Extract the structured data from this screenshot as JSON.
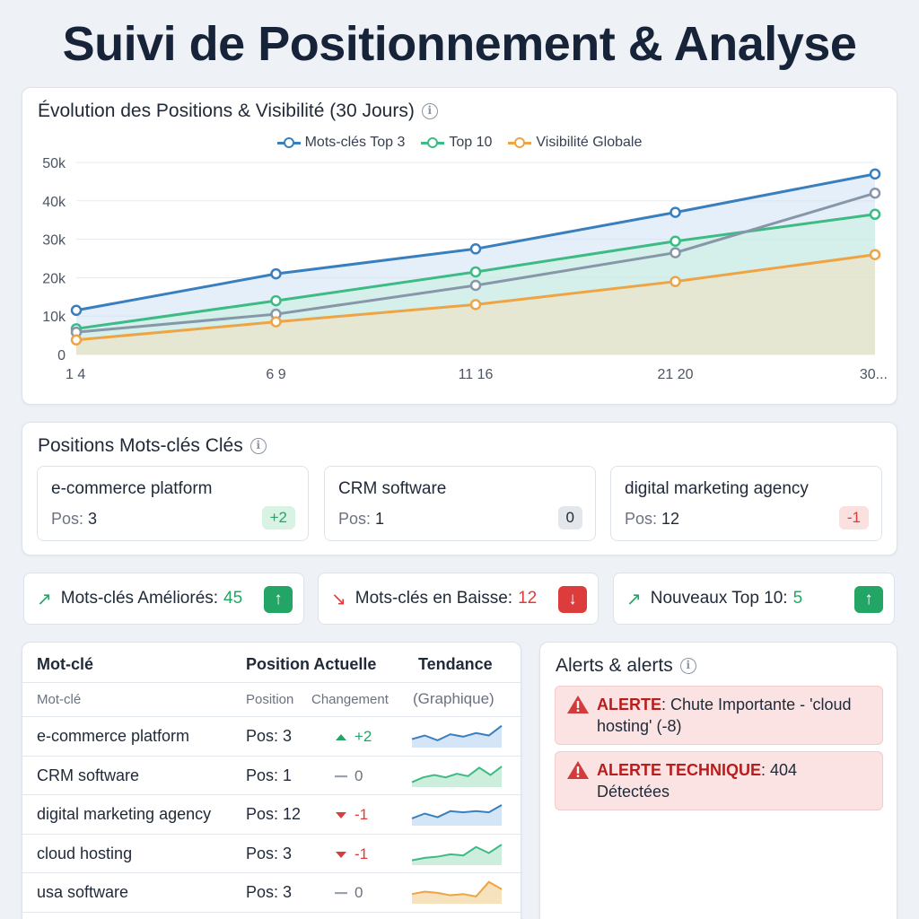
{
  "page": {
    "title": "Suivi de Positionnement & Analyse"
  },
  "chart_card": {
    "title": "Évolution des Positions & Visibilité (30 Jours)",
    "info_icon": "info-icon"
  },
  "chart_data": {
    "type": "line",
    "title": "Évolution des Positions & Visibilité (30 Jours)",
    "x_tick_labels": [
      "1 4",
      "6 9",
      "11 16",
      "21 20",
      "30..."
    ],
    "y_tick_labels": [
      "0",
      "10k",
      "20k",
      "30k",
      "40k",
      "50k"
    ],
    "ylim": [
      0,
      50000
    ],
    "grid": true,
    "legend_position": "top-center",
    "series": [
      {
        "name": "Mots-clés Top 3",
        "color": "#3a7fbd",
        "fill": "#cfe2f6",
        "values": [
          11500,
          21000,
          27500,
          37000,
          47000
        ]
      },
      {
        "name": "Top 10",
        "color": "#3dbb84",
        "fill": "#c9efdc",
        "values": [
          6700,
          14000,
          21500,
          29500,
          36500
        ]
      },
      {
        "name": "",
        "color": "#8796a8",
        "fill": "",
        "values": [
          5800,
          10500,
          18000,
          26500,
          42000
        ]
      },
      {
        "name": "Visibilité Globale",
        "color": "#eea443",
        "fill": "#f3e0bf",
        "values": [
          3800,
          8500,
          13000,
          19000,
          26000
        ]
      }
    ]
  },
  "keyword_positions": {
    "title": "Positions Mots-clés Clés",
    "items": [
      {
        "name": "e-commerce platform",
        "pos_label": "Pos:",
        "pos": "3",
        "change": "+2",
        "tone": "up"
      },
      {
        "name": "CRM software",
        "pos_label": "Pos:",
        "pos": "1",
        "change": "0",
        "tone": "flat"
      },
      {
        "name": "digital marketing agency",
        "pos_label": "Pos:",
        "pos": "12",
        "change": "-1",
        "tone": "down"
      }
    ]
  },
  "stats": [
    {
      "label": "Mots-clés Améliorés:",
      "value": "45",
      "tone": "up",
      "arrow": "↗",
      "button": "↑"
    },
    {
      "label": "Mots-clés en Baisse:",
      "value": "12",
      "tone": "down",
      "arrow": "↘",
      "button": "↓"
    },
    {
      "label": "Nouveaux Top 10:",
      "value": "5",
      "tone": "up",
      "arrow": "↗",
      "button": "↑"
    }
  ],
  "table": {
    "headers": [
      "Mot-clé",
      "Position Actuelle",
      "Tendance"
    ],
    "subheaders": [
      "Mot-clé",
      "Position",
      "Changement",
      "(Graphique)"
    ],
    "rows": [
      {
        "keyword": "e-commerce platform",
        "position": "Pos: 3",
        "change": "+2",
        "dir": "up",
        "spark": [
          0.35,
          0.5,
          0.3,
          0.55,
          0.45,
          0.6,
          0.5,
          0.9
        ],
        "color": "#3a7fbd",
        "fill": "#d3e5f7"
      },
      {
        "keyword": "CRM software",
        "position": "Pos: 1",
        "change": "0",
        "dir": "flat",
        "spark": [
          0.2,
          0.4,
          0.5,
          0.4,
          0.55,
          0.45,
          0.8,
          0.5,
          0.85
        ],
        "color": "#3dbb84",
        "fill": "#cdeedd"
      },
      {
        "keyword": "digital marketing agency",
        "position": "Pos: 12",
        "change": "-1",
        "dir": "down",
        "spark": [
          0.3,
          0.5,
          0.35,
          0.6,
          0.55,
          0.6,
          0.55,
          0.85
        ],
        "color": "#3a7fbd",
        "fill": "#d3e5f7"
      },
      {
        "keyword": "cloud hosting",
        "position": "Pos: 3",
        "change": "-1",
        "dir": "down",
        "spark": [
          0.2,
          0.3,
          0.35,
          0.45,
          0.4,
          0.75,
          0.5,
          0.85
        ],
        "color": "#3dbb84",
        "fill": "#cdeedd"
      },
      {
        "keyword": "usa software",
        "position": "Pos: 3",
        "change": "0",
        "dir": "flat",
        "spark": [
          0.4,
          0.5,
          0.45,
          0.35,
          0.4,
          0.3,
          0.9,
          0.6
        ],
        "color": "#eea443",
        "fill": "#f6e2bd"
      }
    ]
  },
  "alerts": {
    "title": "Alerts & alerts",
    "items": [
      {
        "label": "ALERTE",
        "text": ": Chute Importante - 'cloud hosting' (-8)"
      },
      {
        "label": "ALERTE TECHNIQUE",
        "text": ": 404 Détectées"
      }
    ]
  },
  "colors": {
    "up": "#22a565",
    "down": "#dc3c3c",
    "flat": "#9aa3ad",
    "up_bg": "#d8f3e3",
    "down_bg": "#fbe0e0",
    "flat_bg": "#e3e6ea"
  }
}
